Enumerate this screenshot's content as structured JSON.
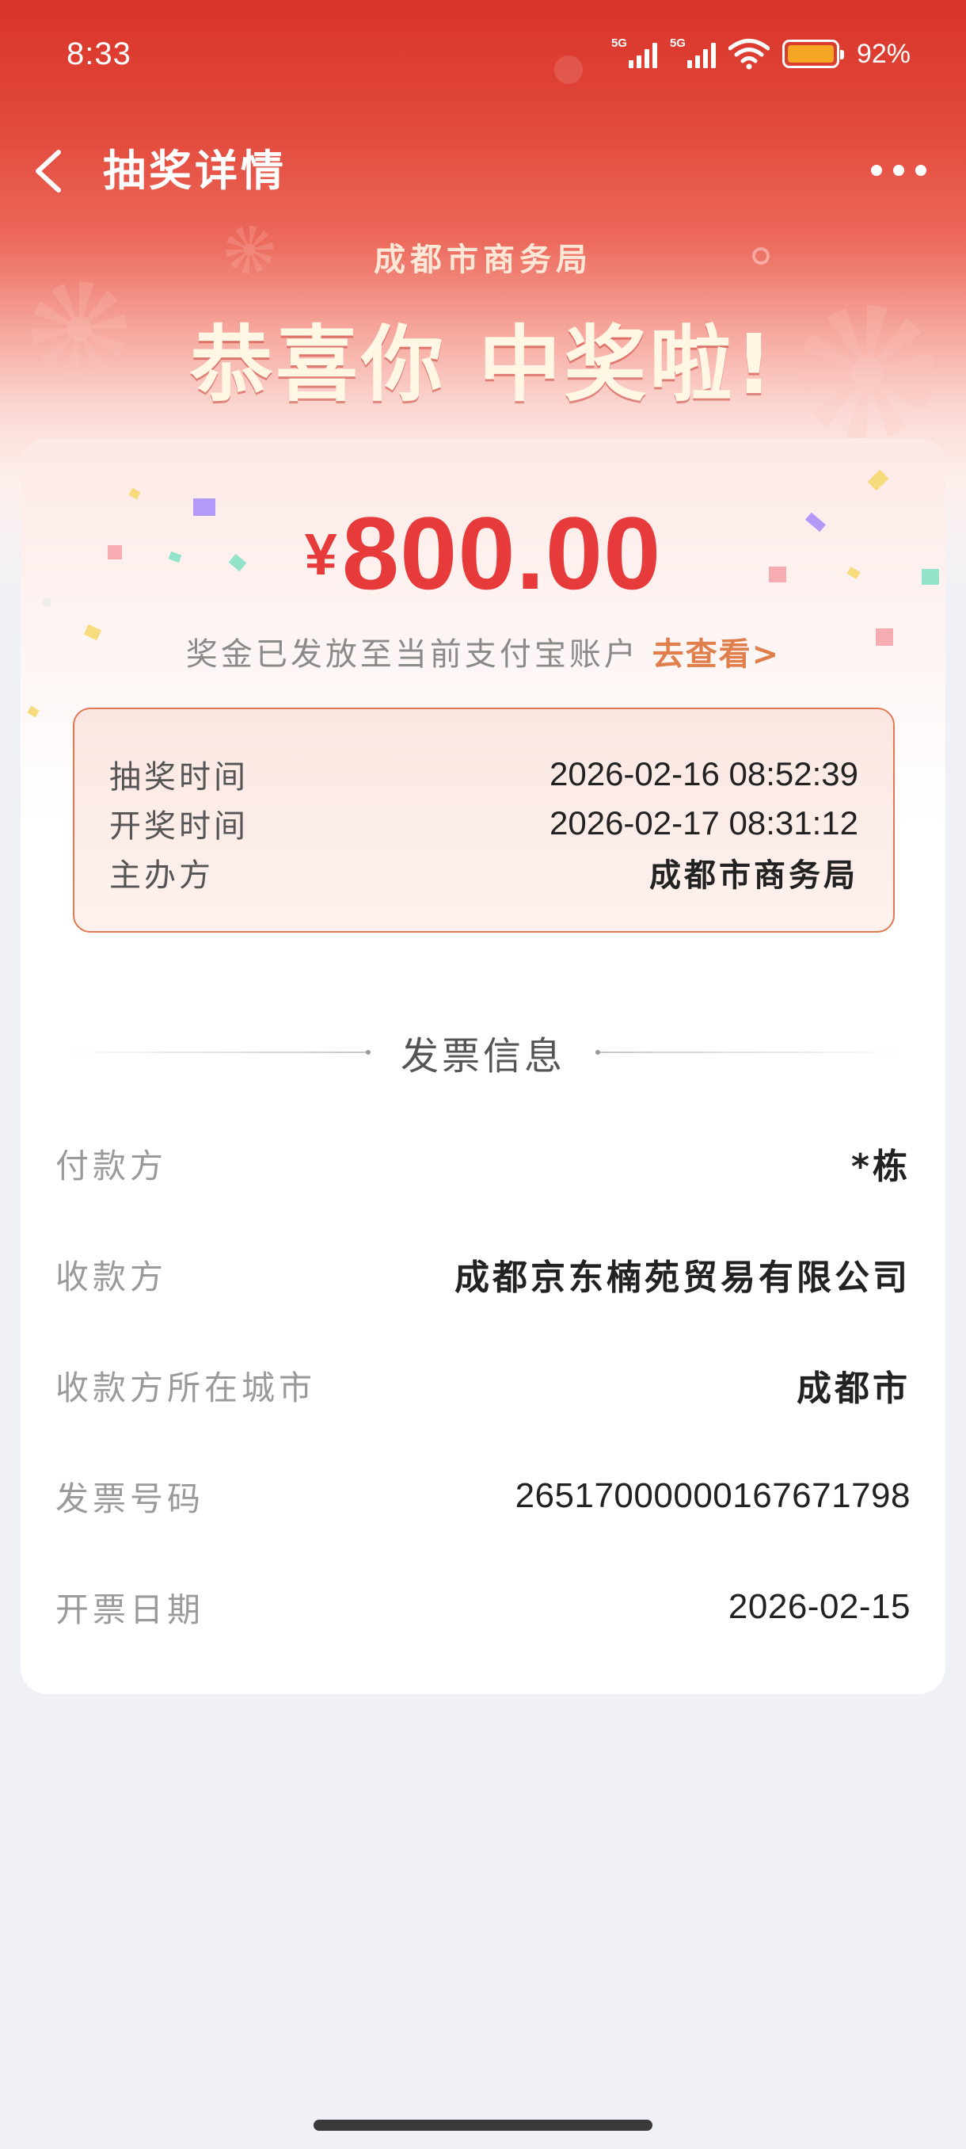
{
  "status_bar": {
    "time": "8:33",
    "signal1_tag": "5G",
    "signal2_tag": "5G",
    "battery": "92%",
    "icons": [
      "signal-icon",
      "signal-icon",
      "wifi-icon",
      "battery-icon"
    ]
  },
  "nav": {
    "title": "抽奖详情",
    "back_icon": "chevron-left-icon",
    "more_icon": "more-icon"
  },
  "hero": {
    "organizer": "成都市商务局",
    "headline": "恭喜你 中奖啦!"
  },
  "prize": {
    "currency": "¥",
    "amount": "800.00",
    "payout_text": "奖金已发放至当前支付宝账户",
    "payout_link": "去查看>"
  },
  "draw_info": {
    "rows": [
      {
        "label": "抽奖时间",
        "value": "2026-02-16 08:52:39"
      },
      {
        "label": "开奖时间",
        "value": "2026-02-17 08:31:12"
      },
      {
        "label": "主办方",
        "value": "成都市商务局"
      }
    ]
  },
  "invoice": {
    "section_title": "发票信息",
    "rows": [
      {
        "label": "付款方",
        "value": "*栋"
      },
      {
        "label": "收款方",
        "value": "成都京东楠苑贸易有限公司"
      },
      {
        "label": "收款方所在城市",
        "value": "成都市"
      },
      {
        "label": "发票号码",
        "value": "26517000000167671798"
      },
      {
        "label": "开票日期",
        "value": "2026-02-15"
      }
    ]
  },
  "colors": {
    "header_red": "#d93429",
    "amount_red": "#e73b3b",
    "link_orange": "#e07e4c",
    "box_border": "#e07a55",
    "page_bg": "#eff1f6"
  }
}
